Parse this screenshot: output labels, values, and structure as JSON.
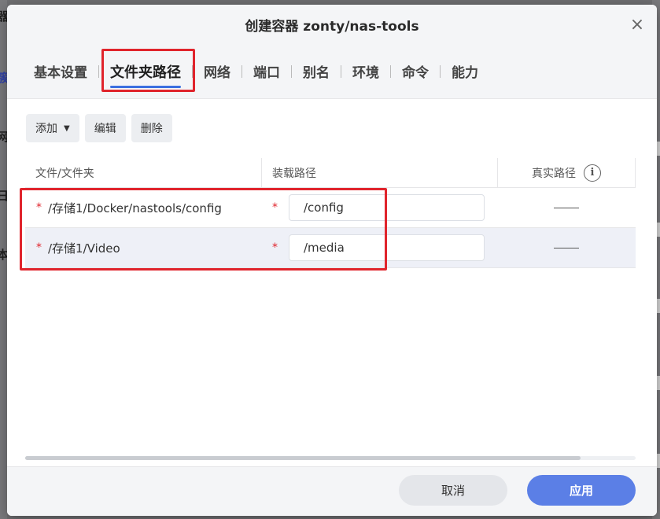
{
  "background": {
    "left_glyphs": [
      "器",
      "簇",
      "网",
      "日",
      "本"
    ]
  },
  "dialog": {
    "title": "创建容器 zonty/nas-tools",
    "close_glyph": "×"
  },
  "tabs": [
    {
      "label": "基本设置",
      "active": false
    },
    {
      "label": "文件夹路径",
      "active": true
    },
    {
      "label": "网络",
      "active": false
    },
    {
      "label": "端口",
      "active": false
    },
    {
      "label": "别名",
      "active": false
    },
    {
      "label": "环境",
      "active": false
    },
    {
      "label": "命令",
      "active": false
    },
    {
      "label": "能力",
      "active": false
    }
  ],
  "toolbar": {
    "add_label": "添加",
    "edit_label": "编辑",
    "delete_label": "删除"
  },
  "table": {
    "headers": {
      "file": "文件/文件夹",
      "mount": "装载路径",
      "real": "真实路径",
      "info_glyph": "i"
    },
    "rows": [
      {
        "required": "*",
        "file": "/存储1/Docker/nastools/config",
        "mount": "/config",
        "real": "——"
      },
      {
        "required": "*",
        "file": "/存储1/Video",
        "mount": "/media",
        "real": "——"
      }
    ]
  },
  "scroll": {
    "position": 0.91
  },
  "footer": {
    "cancel_label": "取消",
    "apply_label": "应用"
  },
  "colors": {
    "accent": "#3b6fe0",
    "apply_button": "#5b7fe6",
    "annotation_red": "#e0242c",
    "required_mark": "#e0242c"
  }
}
